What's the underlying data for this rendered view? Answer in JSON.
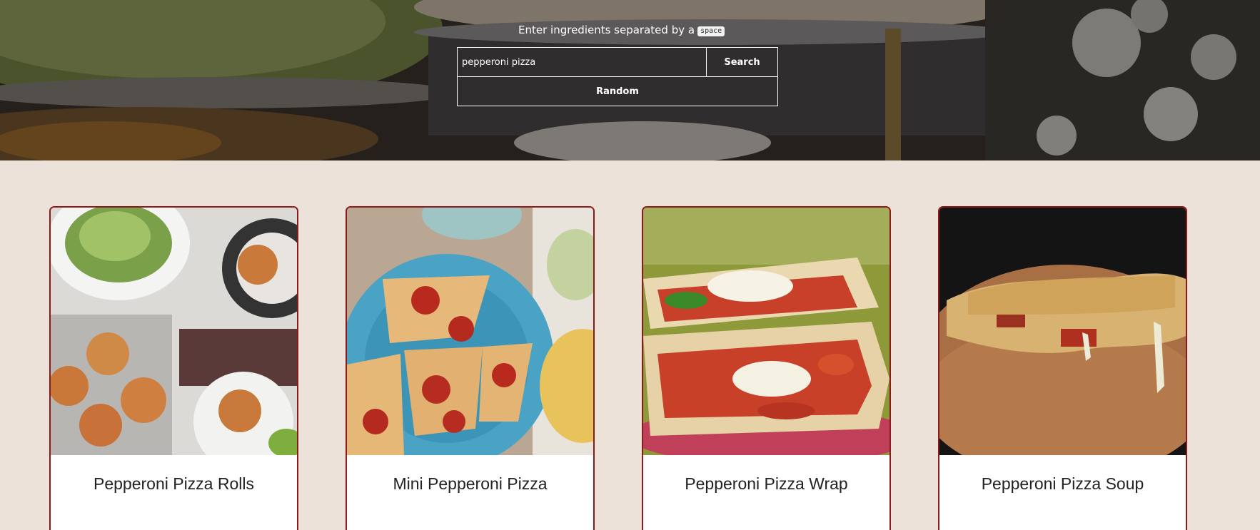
{
  "search": {
    "hint_text": "Enter ingredients separated by a",
    "hint_key": "space",
    "input_value": "pepperoni pizza",
    "search_label": "Search",
    "random_label": "Random"
  },
  "recipes": [
    {
      "title": "Pepperoni Pizza Rolls"
    },
    {
      "title": "Mini Pepperoni Pizza"
    },
    {
      "title": "Pepperoni Pizza Wrap"
    },
    {
      "title": "Pepperoni Pizza Soup"
    }
  ],
  "colors": {
    "page_background": "#ece2da",
    "card_border": "#8b1a1a"
  }
}
